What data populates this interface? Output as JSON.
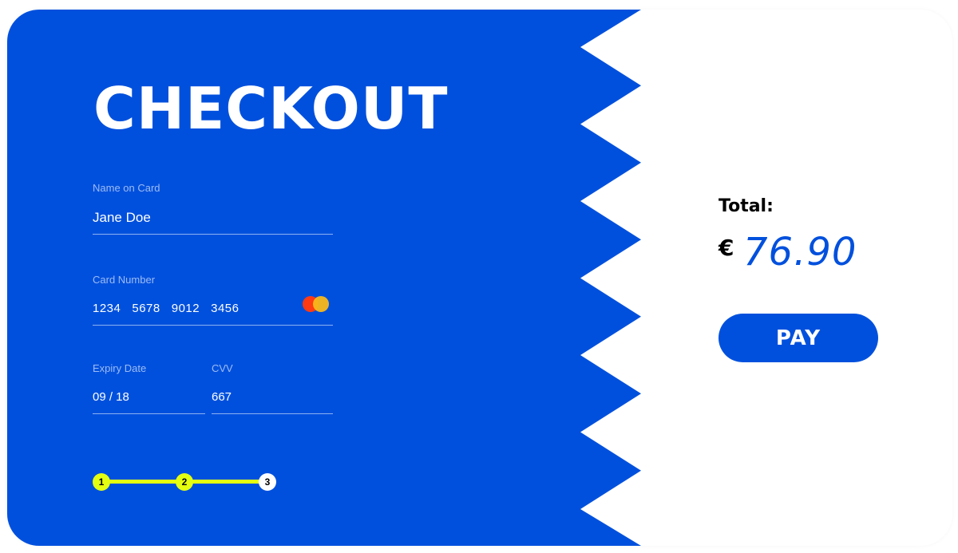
{
  "header": {
    "title": "CHECKOUT"
  },
  "form": {
    "name": {
      "label": "Name on Card",
      "value": "Jane Doe"
    },
    "card_number": {
      "label": "Card Number",
      "value": "1234   5678   9012   3456"
    },
    "expiry": {
      "label": "Expiry Date",
      "value": "09 / 18"
    },
    "cvv": {
      "label": "CVV",
      "value": "667"
    },
    "card_brand_icon": "mastercard-icon"
  },
  "stepper": {
    "steps": [
      "1",
      "2",
      "3"
    ],
    "current_step": 3,
    "active_color": "#e5ff10"
  },
  "summary": {
    "total_label": "Total:",
    "currency": "€",
    "amount": "76.90",
    "pay_label": "PAY"
  },
  "colors": {
    "brand_blue": "#0050dd",
    "text_white": "#ffffff",
    "step_yellow": "#e5ff10"
  }
}
